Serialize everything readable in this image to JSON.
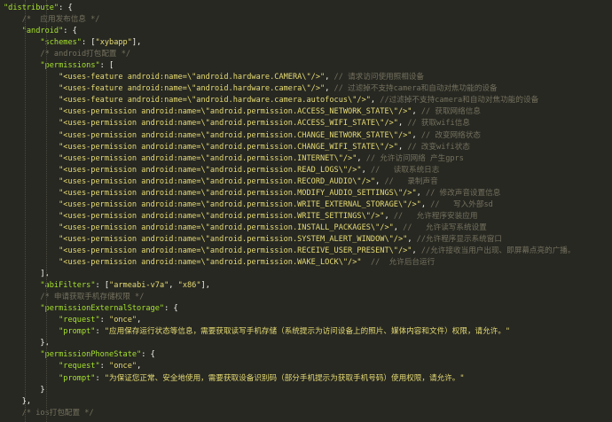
{
  "editor": {
    "indent_unit": "    ",
    "lines": [
      {
        "indent": 0,
        "tokens": [
          {
            "t": "s",
            "v": "\"distribute\""
          },
          {
            "t": "p",
            "v": ": {"
          }
        ]
      },
      {
        "indent": 1,
        "tokens": [
          {
            "t": "c",
            "v": "/*  应用发布信息 */"
          }
        ]
      },
      {
        "indent": 1,
        "tokens": [
          {
            "t": "s",
            "v": "\"android\""
          },
          {
            "t": "p",
            "v": ": {"
          }
        ]
      },
      {
        "indent": 2,
        "tokens": [
          {
            "t": "s",
            "v": "\"schemes\""
          },
          {
            "t": "p",
            "v": ": ["
          },
          {
            "t": "s",
            "v": "\"xybapp\""
          },
          {
            "t": "p",
            "v": "],"
          }
        ]
      },
      {
        "indent": 2,
        "tokens": [
          {
            "t": "c",
            "v": "/* android打包配置 */"
          }
        ]
      },
      {
        "indent": 2,
        "tokens": [
          {
            "t": "s",
            "v": "\"permissions\""
          },
          {
            "t": "p",
            "v": ": ["
          }
        ]
      },
      {
        "indent": 3,
        "tokens": [
          {
            "t": "s",
            "v": "\"<uses-feature android:name=\\\"android.hardware.CAMERA\\\"/>\""
          },
          {
            "t": "p",
            "v": ", "
          },
          {
            "t": "c",
            "v": "// 请求访问使用照相设备"
          }
        ]
      },
      {
        "indent": 3,
        "tokens": [
          {
            "t": "s",
            "v": "\"<uses-feature android:name=\\\"android.hardware.camera\\\"/>\""
          },
          {
            "t": "p",
            "v": ", "
          },
          {
            "t": "c",
            "v": "// 过滤掉不支持camera和自动对焦功能的设备"
          }
        ]
      },
      {
        "indent": 3,
        "tokens": [
          {
            "t": "s",
            "v": "\"<uses-feature android:name=\\\"android.hardware.camera.autofocus\\\"/>\""
          },
          {
            "t": "p",
            "v": ", "
          },
          {
            "t": "c",
            "v": "//过滤掉不支持camera和自动对焦功能的设备"
          }
        ]
      },
      {
        "indent": 3,
        "tokens": [
          {
            "t": "s",
            "v": "\"<uses-permission android:name=\\\"android.permission.ACCESS_NETWORK_STATE\\\"/>\""
          },
          {
            "t": "p",
            "v": ", "
          },
          {
            "t": "c",
            "v": "// 获取网络信息"
          }
        ]
      },
      {
        "indent": 3,
        "tokens": [
          {
            "t": "s",
            "v": "\"<uses-permission android:name=\\\"android.permission.ACCESS_WIFI_STATE\\\"/>\""
          },
          {
            "t": "p",
            "v": ", "
          },
          {
            "t": "c",
            "v": "// 获取wifi信息"
          }
        ]
      },
      {
        "indent": 3,
        "tokens": [
          {
            "t": "s",
            "v": "\"<uses-permission android:name=\\\"android.permission.CHANGE_NETWORK_STATE\\\"/>\""
          },
          {
            "t": "p",
            "v": ", "
          },
          {
            "t": "c",
            "v": "// 改变网络状态"
          }
        ]
      },
      {
        "indent": 3,
        "tokens": [
          {
            "t": "s",
            "v": "\"<uses-permission android:name=\\\"android.permission.CHANGE_WIFI_STATE\\\"/>\""
          },
          {
            "t": "p",
            "v": ", "
          },
          {
            "t": "c",
            "v": "// 改变wifi状态"
          }
        ]
      },
      {
        "indent": 3,
        "tokens": [
          {
            "t": "s",
            "v": "\"<uses-permission android:name=\\\"android.permission.INTERNET\\\"/>\""
          },
          {
            "t": "p",
            "v": ", "
          },
          {
            "t": "c",
            "v": "// 允许访问网络 产生gprs"
          }
        ]
      },
      {
        "indent": 3,
        "tokens": [
          {
            "t": "s",
            "v": "\"<uses-permission android:name=\\\"android.permission.READ_LOGS\\\"/>\""
          },
          {
            "t": "p",
            "v": ", "
          },
          {
            "t": "c",
            "v": "//   读取系统日志"
          }
        ]
      },
      {
        "indent": 3,
        "tokens": [
          {
            "t": "s",
            "v": "\"<uses-permission android:name=\\\"android.permission.RECORD_AUDIO\\\"/>\""
          },
          {
            "t": "p",
            "v": ", "
          },
          {
            "t": "c",
            "v": "//   录制声音"
          }
        ]
      },
      {
        "indent": 3,
        "tokens": [
          {
            "t": "s",
            "v": "\"<uses-permission android:name=\\\"android.permission.MODIFY_AUDIO_SETTINGS\\\"/>\""
          },
          {
            "t": "p",
            "v": ", "
          },
          {
            "t": "c",
            "v": "// 修改声音设置信息"
          }
        ]
      },
      {
        "indent": 3,
        "tokens": [
          {
            "t": "s",
            "v": "\"<uses-permission android:name=\\\"android.permission.WRITE_EXTERNAL_STORAGE\\\"/>\""
          },
          {
            "t": "p",
            "v": ", "
          },
          {
            "t": "c",
            "v": "//   写入外部sd"
          }
        ]
      },
      {
        "indent": 3,
        "tokens": [
          {
            "t": "s",
            "v": "\"<uses-permission android:name=\\\"android.permission.WRITE_SETTINGS\\\"/>\""
          },
          {
            "t": "p",
            "v": ", "
          },
          {
            "t": "c",
            "v": "//   允许程序安装应用"
          }
        ]
      },
      {
        "indent": 3,
        "tokens": [
          {
            "t": "s",
            "v": "\"<uses-permission android:name=\\\"android.permission.INSTALL_PACKAGES\\\"/>\""
          },
          {
            "t": "p",
            "v": ", "
          },
          {
            "t": "c",
            "v": "//   允许读写系统设置"
          }
        ]
      },
      {
        "indent": 3,
        "tokens": [
          {
            "t": "s",
            "v": "\"<uses-permission android:name=\\\"android.permission.SYSTEM_ALERT_WINDOW\\\"/>\""
          },
          {
            "t": "p",
            "v": ", "
          },
          {
            "t": "c",
            "v": "//允许程序显示系统窗口"
          }
        ]
      },
      {
        "indent": 3,
        "tokens": [
          {
            "t": "s",
            "v": "\"<uses-permission android:name=\\\"android.permission.RECEIVE_USER_PRESENT\\\"/>\""
          },
          {
            "t": "p",
            "v": ", "
          },
          {
            "t": "c",
            "v": "//允许接收当用户出现、即屏幕点亮的广播。"
          }
        ]
      },
      {
        "indent": 3,
        "tokens": [
          {
            "t": "s",
            "v": "\"<uses-permission android:name=\\\"android.permission.WAKE_LOCK\\\"/>\""
          },
          {
            "t": "p",
            "v": "  "
          },
          {
            "t": "c",
            "v": "//  允许后台运行"
          }
        ]
      },
      {
        "indent": 2,
        "tokens": [
          {
            "t": "p",
            "v": "],"
          }
        ]
      },
      {
        "indent": 2,
        "tokens": [
          {
            "t": "s",
            "v": "\"abiFilters\""
          },
          {
            "t": "p",
            "v": ": ["
          },
          {
            "t": "s",
            "v": "\"armeabi-v7a\""
          },
          {
            "t": "p",
            "v": ", "
          },
          {
            "t": "s",
            "v": "\"x86\""
          },
          {
            "t": "p",
            "v": "],"
          }
        ]
      },
      {
        "indent": 2,
        "tokens": [
          {
            "t": "c",
            "v": "/* 申请获取手机存储权限 */"
          }
        ]
      },
      {
        "indent": 2,
        "tokens": [
          {
            "t": "s",
            "v": "\"permissionExternalStorage\""
          },
          {
            "t": "p",
            "v": ": {"
          }
        ]
      },
      {
        "indent": 3,
        "tokens": [
          {
            "t": "s",
            "v": "\"request\""
          },
          {
            "t": "p",
            "v": ": "
          },
          {
            "t": "s",
            "v": "\"once\""
          },
          {
            "t": "p",
            "v": ","
          }
        ]
      },
      {
        "indent": 3,
        "tokens": [
          {
            "t": "s",
            "v": "\"prompt\""
          },
          {
            "t": "p",
            "v": ": "
          },
          {
            "t": "s",
            "v": "\"应用保存运行状态等信息，需要获取读写手机存储（系统提示为访问设备上的照片、媒体内容和文件）权限，请允许。\""
          }
        ]
      },
      {
        "indent": 2,
        "tokens": [
          {
            "t": "p",
            "v": "},"
          }
        ]
      },
      {
        "indent": 2,
        "tokens": [
          {
            "t": "s",
            "v": "\"permissionPhoneState\""
          },
          {
            "t": "p",
            "v": ": {"
          }
        ]
      },
      {
        "indent": 3,
        "tokens": [
          {
            "t": "s",
            "v": "\"request\""
          },
          {
            "t": "p",
            "v": ": "
          },
          {
            "t": "s",
            "v": "\"once\""
          },
          {
            "t": "p",
            "v": ","
          }
        ]
      },
      {
        "indent": 3,
        "tokens": [
          {
            "t": "s",
            "v": "\"prompt\""
          },
          {
            "t": "p",
            "v": ": "
          },
          {
            "t": "s",
            "v": "\"为保证您正常、安全地使用，需要获取设备识别码（部分手机提示为获取手机号码）使用权限，请允许。\""
          }
        ]
      },
      {
        "indent": 2,
        "tokens": [
          {
            "t": "p",
            "v": "}"
          }
        ]
      },
      {
        "indent": 1,
        "tokens": [
          {
            "t": "p",
            "v": "},"
          }
        ]
      },
      {
        "indent": 1,
        "tokens": [
          {
            "t": "c",
            "v": "/* ios打包配置 */"
          }
        ]
      }
    ]
  }
}
